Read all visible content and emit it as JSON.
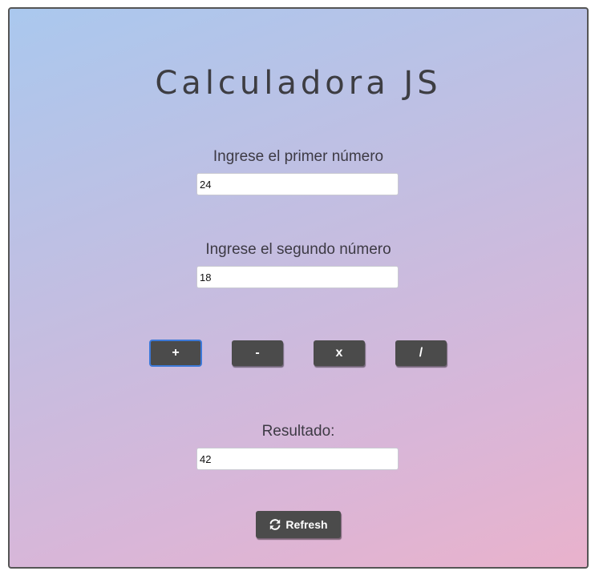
{
  "page": {
    "title": "Calculadora JS"
  },
  "form": {
    "first_label": "Ingrese el primer número",
    "first_value": "24",
    "second_label": "Ingrese el segundo número",
    "second_value": "18",
    "result_label": "Resultado:",
    "result_value": "42"
  },
  "operations": {
    "add": "+",
    "subtract": "-",
    "multiply": "x",
    "divide": "/"
  },
  "refresh": {
    "label": "Refresh",
    "icon": "refresh-icon"
  },
  "colors": {
    "button_bg": "#4b4b4b",
    "focus_ring": "#3d79d8",
    "text_dark": "#3d3d42"
  }
}
